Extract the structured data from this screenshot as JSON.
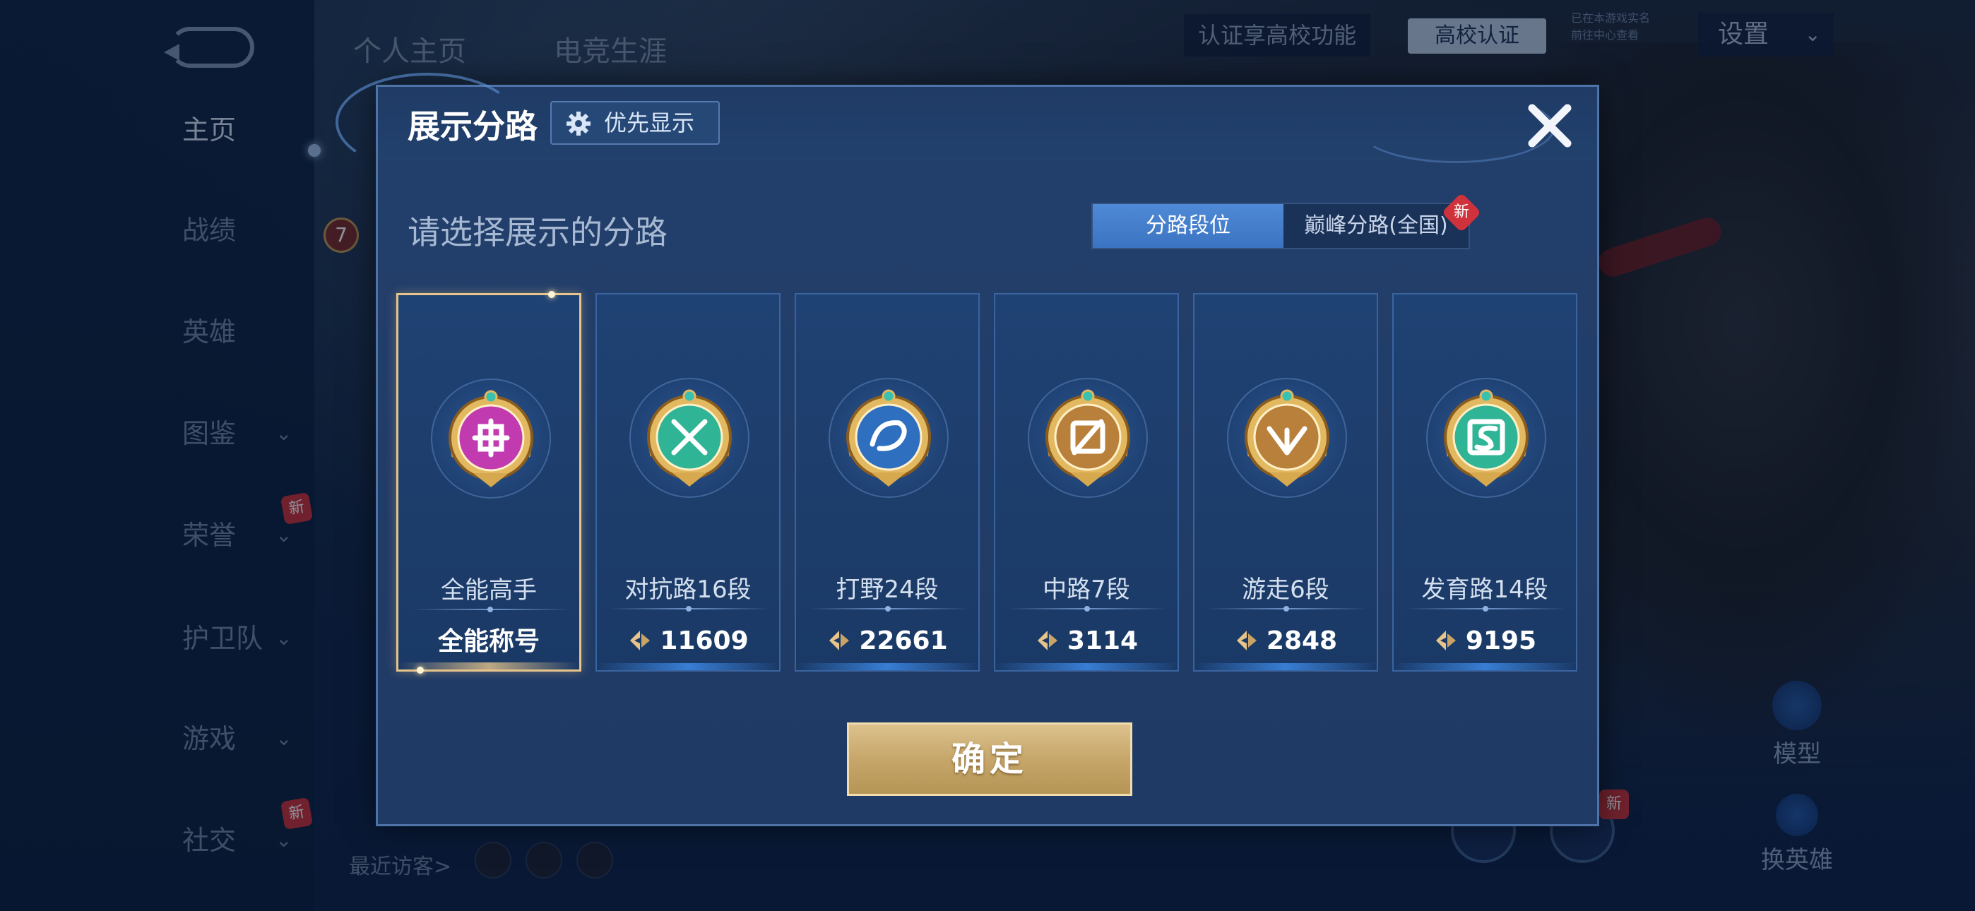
{
  "background": {
    "top_tabs": [
      "个人主页",
      "电竞生涯"
    ],
    "cert_text": "认证享高校功能",
    "school_button": "高校认证",
    "school_note_lines": [
      "已在本游戏实名",
      "前往中心查看"
    ],
    "settings_label": "设置",
    "sidebar": [
      {
        "label": "主页",
        "active": true,
        "chevron": false,
        "new": false
      },
      {
        "label": "战绩",
        "active": false,
        "chevron": false,
        "new": false
      },
      {
        "label": "英雄",
        "active": false,
        "chevron": false,
        "new": false
      },
      {
        "label": "图鉴",
        "active": false,
        "chevron": true,
        "new": false
      },
      {
        "label": "荣誉",
        "active": false,
        "chevron": true,
        "new": true
      },
      {
        "label": "护卫队",
        "active": false,
        "chevron": true,
        "new": false
      },
      {
        "label": "游戏",
        "active": false,
        "chevron": true,
        "new": false
      },
      {
        "label": "社交",
        "active": false,
        "chevron": true,
        "new": true
      }
    ],
    "new_badge": "新",
    "recent_visitors": "最近访客>",
    "level_badge": "7",
    "right_buttons": {
      "model": "模型",
      "change_hero": "换英雄"
    }
  },
  "modal": {
    "title": "展示分路",
    "priority_label": "优先显示",
    "subtitle": "请选择展示的分路",
    "segments": [
      {
        "label": "分路段位",
        "active": true
      },
      {
        "label": "巅峰分路(全国)",
        "active": false,
        "new": true
      }
    ],
    "segment_new_badge": "新",
    "cards": [
      {
        "name": "全能高手",
        "value": "全能称号",
        "show_icon": false,
        "selected": true,
        "badge_color": "#c23ab0",
        "badge_icon": "diamond-knot-icon"
      },
      {
        "name": "对抗路16段",
        "value": "11609",
        "show_icon": true,
        "selected": false,
        "badge_color": "#2fb596",
        "badge_icon": "crossed-swords-icon"
      },
      {
        "name": "打野24段",
        "value": "22661",
        "show_icon": true,
        "selected": false,
        "badge_color": "#2f6fc0",
        "badge_icon": "dragon-icon"
      },
      {
        "name": "中路7段",
        "value": "3114",
        "show_icon": true,
        "selected": false,
        "badge_color": "#b8803a",
        "badge_icon": "slash-icon"
      },
      {
        "name": "游走6段",
        "value": "2848",
        "show_icon": true,
        "selected": false,
        "badge_color": "#b8803a",
        "badge_icon": "wings-icon"
      },
      {
        "name": "发育路14段",
        "value": "9195",
        "show_icon": true,
        "selected": false,
        "badge_color": "#2fb596",
        "badge_icon": "s-icon"
      }
    ],
    "confirm_label": "确定"
  },
  "colors": {
    "gold": "#e6c48a",
    "accent_blue": "#3b74c2",
    "new_red": "#d0323c"
  }
}
